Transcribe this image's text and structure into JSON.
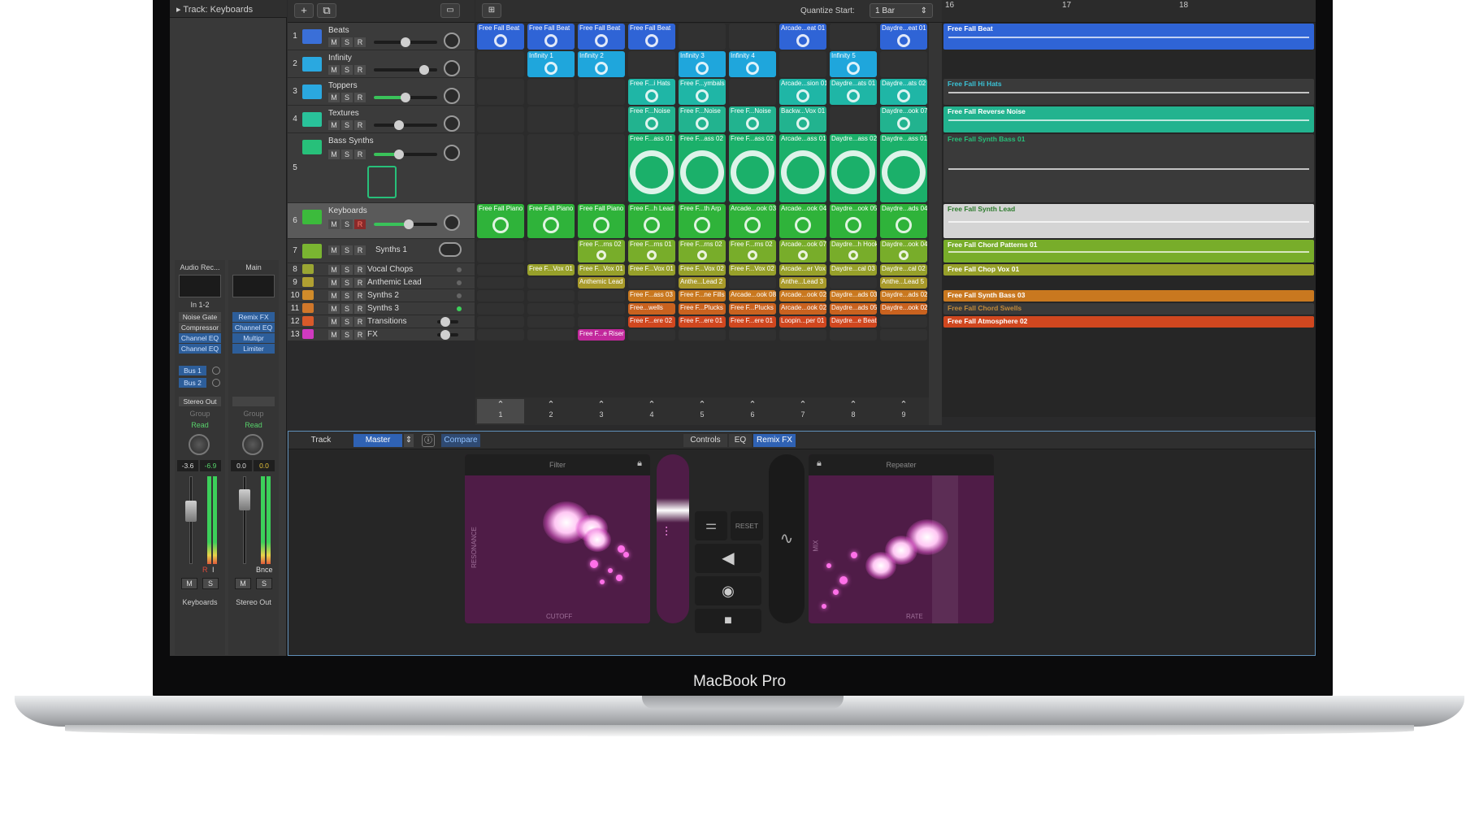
{
  "laptop": {
    "label": "MacBook Pro"
  },
  "inspector": {
    "header": "Track: Keyboards",
    "strips": [
      {
        "top_label": "Audio Rec...",
        "input": "In 1-2",
        "plugins": [
          "Noise Gate",
          "Compressor",
          "Channel EQ",
          "Channel EQ"
        ],
        "sends": [
          "Bus 1",
          "Bus 2"
        ],
        "output": "Stereo Out",
        "group": "Group",
        "automation": "Read",
        "vol": "-3.6",
        "peak": "-6.9",
        "mute": "M",
        "solo": "S",
        "record": "R",
        "input_mon": "I",
        "name": "Keyboards"
      },
      {
        "top_label": "Main",
        "input": "",
        "plugins": [
          "Remix FX",
          "Channel EQ",
          "Multipr",
          "Limiter"
        ],
        "sends": [],
        "output": "",
        "group": "Group",
        "automation": "Read",
        "vol": "0.0",
        "peak": "0.0",
        "mute": "M",
        "solo": "S",
        "bounce": "Bnce",
        "name": "Stereo Out"
      }
    ]
  },
  "toolbar": {
    "add": "+",
    "quantize_label": "Quantize Start:",
    "quantize_value": "1 Bar"
  },
  "tracks": [
    {
      "num": "1",
      "name": "Beats",
      "mute": "M",
      "solo": "S",
      "rec": "R",
      "color": "#3a6fd8"
    },
    {
      "num": "2",
      "name": "Infinity",
      "mute": "M",
      "solo": "S",
      "rec": "R",
      "color": "#2aa8e0"
    },
    {
      "num": "3",
      "name": "Toppers",
      "mute": "M",
      "solo": "S",
      "rec": "R",
      "color": "#2aa8e0"
    },
    {
      "num": "4",
      "name": "Textures",
      "mute": "M",
      "solo": "S",
      "rec": "R",
      "color": "#29c29a"
    },
    {
      "num": "5",
      "name": "Bass Synths",
      "mute": "M",
      "solo": "S",
      "rec": "R",
      "color": "#27c07a"
    },
    {
      "num": "6",
      "name": "Keyboards",
      "mute": "M",
      "solo": "S",
      "rec": "R",
      "color": "#3cbb3c"
    },
    {
      "num": "7",
      "name": "Synths 1",
      "mute": "M",
      "solo": "S",
      "rec": "R",
      "color": "#7ab531"
    },
    {
      "num": "8",
      "name": "Vocal Chops",
      "mute": "M",
      "solo": "S",
      "rec": "R",
      "color": "#9aa633"
    },
    {
      "num": "9",
      "name": "Anthemic Lead",
      "mute": "M",
      "solo": "S",
      "rec": "R",
      "color": "#b0a032"
    },
    {
      "num": "10",
      "name": "Synths 2",
      "mute": "M",
      "solo": "S",
      "rec": "R",
      "color": "#d08b2a"
    },
    {
      "num": "11",
      "name": "Synths 3",
      "mute": "M",
      "solo": "S",
      "rec": "R",
      "color": "#d0772a"
    },
    {
      "num": "12",
      "name": "Transitions",
      "mute": "M",
      "solo": "S",
      "rec": "R",
      "color": "#d85a2a"
    },
    {
      "num": "13",
      "name": "FX",
      "mute": "M",
      "solo": "S",
      "rec": "R",
      "color": "#d03ac0"
    }
  ],
  "cells": [
    [
      "Free Fall Beat",
      "Free Fall Beat",
      "Free Fall Beat",
      "Free Fall Beat",
      "",
      "",
      "Arcade...eat 01",
      "",
      "Daydre...eat 01"
    ],
    [
      "",
      "Infinity 1",
      "Infinity 2",
      "",
      "Infinity 3",
      "Infinity 4",
      "",
      "Infinity 5",
      ""
    ],
    [
      "",
      "",
      "",
      "Free F...i Hats",
      "Free F...ymbals",
      "",
      "Arcade...sion 01",
      "Daydre...ats 01",
      "Daydre...ats 02"
    ],
    [
      "",
      "",
      "",
      "Free F...Noise",
      "Free F...Noise",
      "Free F...Noise",
      "Backw...Vox 01",
      "",
      "Daydre...ook 07"
    ],
    [
      "",
      "",
      "",
      "Free F...ass 01",
      "Free F...ass 02",
      "Free F...ass 02",
      "Arcade...ass 01",
      "Daydre...ass 02",
      "Daydre...ass 01"
    ],
    [
      "Free Fall Piano",
      "Free Fall Piano",
      "Free Fall Piano",
      "Free F...h Lead",
      "Free F...th Arp",
      "Arcade...ook 03",
      "Arcade...ook 04",
      "Daydre...ook 05",
      "Daydre...ads 04"
    ],
    [
      "",
      "",
      "Free F...rns 02",
      "Free F...rns 01",
      "Free F...rns 02",
      "Free F...rns 02",
      "Arcade...ook 07",
      "Daydre...h Hook",
      "Daydre...ook 04"
    ],
    [
      "",
      "Free F...Vox 01",
      "Free F...Vox 01",
      "Free F...Vox 01",
      "Free F...Vox 02",
      "Free F...Vox 02",
      "Arcade...er Vox",
      "Daydre...cal 03",
      "Daydre...cal 02"
    ],
    [
      "",
      "",
      "Anthemic Lead",
      "",
      "Anthe...Lead 2",
      "",
      "Anthe...Lead 3",
      "",
      "Anthe...Lead 5"
    ],
    [
      "",
      "",
      "",
      "Free F...ass 03",
      "Free F...ne Fills",
      "Arcade...ook 08",
      "Arcade...ook 02",
      "Daydre...ads 03",
      "Daydre...ads 02"
    ],
    [
      "",
      "",
      "",
      "Free...wells",
      "Free F...Plucks",
      "Free F...Plucks",
      "Arcade...ook 02",
      "Daydre...ads 05",
      "Daydre...ook 02"
    ],
    [
      "",
      "",
      "",
      "Free F...ere 02",
      "Free F...ere 01",
      "Free F...ere 01",
      "Loopin...per 01",
      "Daydre...e Beat",
      ""
    ],
    [
      "",
      "",
      "Free F...e Riser",
      "",
      "",
      "",
      "",
      "",
      ""
    ]
  ],
  "scenes": [
    "1",
    "2",
    "3",
    "4",
    "5",
    "6",
    "7",
    "8",
    "9"
  ],
  "ruler": [
    "16",
    "17",
    "18"
  ],
  "regions": [
    "Free Fall Beat",
    "",
    "Free Fall Hi Hats",
    "Free Fall Reverse Noise",
    "Free Fall Synth Bass 01",
    "Free Fall Synth Lead",
    "Free Fall Chord Patterns 01",
    "Free Fall Chop Vox 01",
    "",
    "Free Fall Synth Bass 03",
    "Free Fall Chord Swells",
    "Free Fall Atmosphere 02",
    ""
  ],
  "remix": {
    "tabs": {
      "track": "Track",
      "master": "Master",
      "compare": "Compare",
      "controls": "Controls",
      "eq": "EQ",
      "remix_fx": "Remix FX"
    },
    "left_pad": {
      "title": "Filter",
      "x_axis": "CUTOFF",
      "y_axis": "RESONANCE"
    },
    "right_pad": {
      "title": "Repeater",
      "x_axis": "RATE",
      "y_axis": "MIX"
    },
    "reset": "RESET"
  }
}
